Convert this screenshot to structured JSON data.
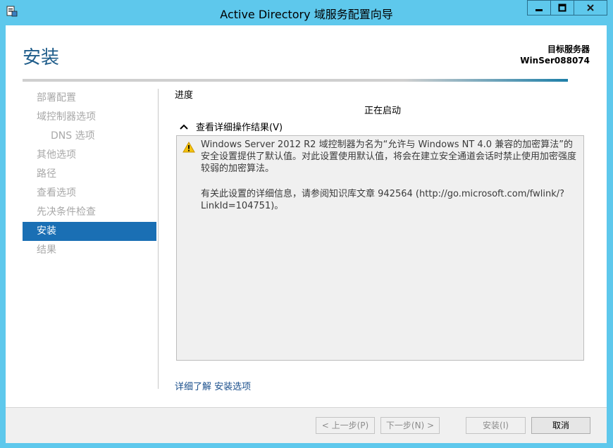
{
  "window": {
    "title": "Active Directory 域服务配置向导",
    "icon": "server-manager-icon",
    "controls": {
      "minimize": "minimize-icon",
      "maximize": "maximize-icon",
      "close": "close-icon"
    }
  },
  "header": {
    "page_title": "安装",
    "target_label": "目标服务器",
    "target_server": "WinSer088074"
  },
  "nav": {
    "items": [
      {
        "label": "部署配置",
        "state": "disabled"
      },
      {
        "label": "域控制器选项",
        "state": "disabled"
      },
      {
        "label": "DNS 选项",
        "state": "disabled"
      },
      {
        "label": "其他选项",
        "state": "disabled"
      },
      {
        "label": "路径",
        "state": "disabled"
      },
      {
        "label": "查看选项",
        "state": "disabled"
      },
      {
        "label": "先决条件检查",
        "state": "disabled"
      },
      {
        "label": "安装",
        "state": "active"
      },
      {
        "label": "结果",
        "state": "disabled"
      }
    ]
  },
  "main": {
    "progress_label": "进度",
    "status_text": "正在启动",
    "details_toggle": "查看详细操作结果(V)",
    "message": {
      "icon": "warning-icon",
      "paragraph1": "Windows Server 2012 R2 域控制器为名为“允许与 Windows NT 4.0 兼容的加密算法”的安全设置提供了默认值。对此设置使用默认值，将会在建立安全通道会话时禁止使用加密强度较弱的加密算法。",
      "paragraph2": "有关此设置的详细信息，请参阅知识库文章 942564 (http://go.microsoft.com/fwlink/?LinkId=104751)。"
    },
    "learn_more_prefix": "详细了解",
    "learn_more_link": "安装选项"
  },
  "footer": {
    "prev": "< 上一步(P)",
    "next": "下一步(N) >",
    "install": "安装(I)",
    "cancel": "取消"
  },
  "colors": {
    "frame": "#5ec8ec",
    "accent": "#1a6fb4",
    "title_text": "#1e5c8a"
  }
}
